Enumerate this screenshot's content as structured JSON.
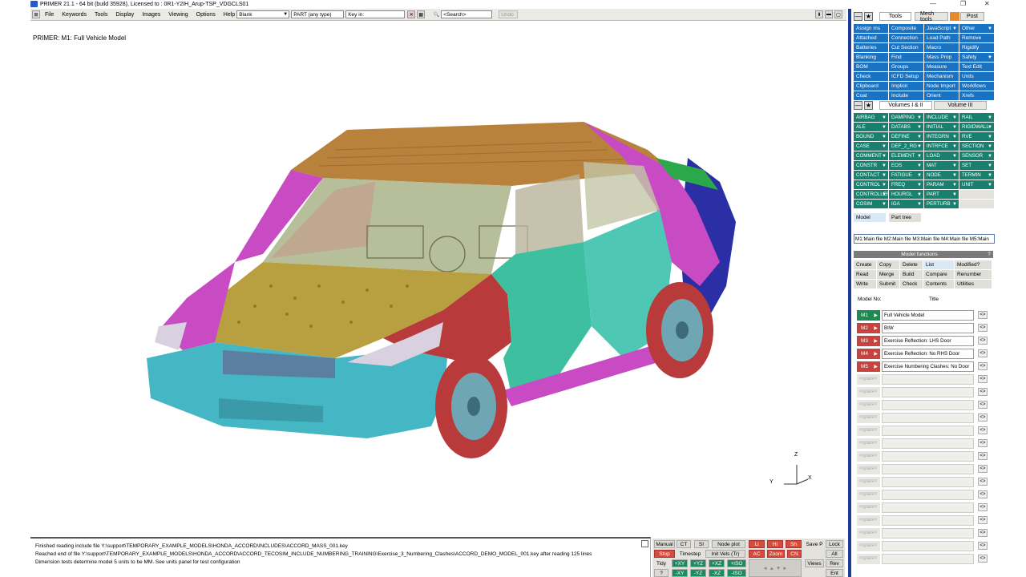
{
  "titlebar": {
    "title": "PRIMER 21.1 - 64 bit (build 35928), Licensed to : 0R1-Y2IH_Arup-TSP_VDGCLS01"
  },
  "menubar": {
    "items": [
      "File",
      "Keywords",
      "Tools",
      "Display",
      "Images",
      "Viewing",
      "Options",
      "Help"
    ],
    "blank_select": "Blank",
    "type_select": "PART  (any type)",
    "key_in_value": "Key in:",
    "search_value": "<Search>",
    "undo_label": "Undo"
  },
  "viewport": {
    "model_label": "PRIMER: M1: Full Vehicle Model",
    "triad": {
      "z": "Z",
      "y": "Y",
      "x": "X"
    }
  },
  "messages": [
    "Finished reading include file Y:\\support\\TEMPORARY_EXAMPLE_MODELS\\HONDA_ACCORD\\INCLUDES\\ACCORD_MASS_001.key",
    "Reached end of file Y:\\support\\TEMPORARY_EXAMPLE_MODELS\\HONDA_ACCORD\\ACCORD_TECOSIM_INCLUDE_NUMBERING_TRAINING\\Exercise_3_Numbering_Clashes\\ACCORD_DEMO_MODEL_001.key after reading 125 lines",
    "Dimension tests determine model 5 units to be MM. See units panel for test configuration"
  ],
  "bottom_controls": {
    "manual": "Manual",
    "ct": "CT",
    "si": "SI",
    "node_plot": "Node plot",
    "lock": "Lock",
    "stop": "Stop",
    "timestep": "Timestep",
    "init_vels": "Init Vels (Tr)",
    "ac": "AC",
    "zoom": "Zoom",
    "cn": "CN",
    "all": "All",
    "tidy": "Tidy",
    "pxy": "+XY",
    "pyz": "+YZ",
    "pxz": "+XZ",
    "piso": "+ISO",
    "views": "Views",
    "rev": "Rev",
    "q": "?",
    "mxy": "-XY",
    "myz": "-YZ",
    "mxz": "-XZ",
    "miso": "-ISO",
    "ent": "Ent",
    "save_p": "Save P",
    "li": "Li",
    "hi": "Hi",
    "sh": "Sh"
  },
  "tools_panel": {
    "tabs": [
      "Tools",
      "Mesh tools",
      "Post"
    ],
    "buttons": [
      "Assign ms",
      "Composite",
      "JavaScript",
      "Other",
      "Attached",
      "Connection",
      "Load Path",
      "Remove",
      "Batteries",
      "Cut Section",
      "Macro",
      "Rigidify",
      "Blanking",
      "Find",
      "Mass Prop",
      "Safety",
      "BOM",
      "Groups",
      "Measure",
      "Text Edit",
      "Check",
      "ICFD Setup",
      "Mechanism",
      "Units",
      "Clipboard",
      "Implicit",
      "Node Import",
      "Workflows",
      "Coat",
      "Include",
      "Orient",
      "Xrefs"
    ],
    "dropdown_buttons": [
      "JavaScript",
      "Other",
      "Safety"
    ]
  },
  "keywords_panel": {
    "tabs": [
      "Volumes I & II",
      "Volume III"
    ],
    "buttons": [
      "AIRBAG",
      "DAMPING",
      "INCLUDE",
      "RAIL",
      "ALE",
      "DATABS",
      "INITIAL",
      "RIGIDWALL",
      "BOUND",
      "DEFINE",
      "INTEGRN",
      "RVE",
      "CASE",
      "DEF_2_RG",
      "INTRFCE",
      "SECTION",
      "COMMENT",
      "ELEMENT",
      "LOAD",
      "SENSOR",
      "CONSTR",
      "EOS",
      "MAT",
      "SET",
      "CONTACT",
      "FATIGUE",
      "NODE",
      "TERMIN",
      "CONTROL",
      "FREQ",
      "PARAM",
      "UNIT",
      "CONTROLLER",
      "HOURGL",
      "PART",
      "",
      "COSIM",
      "IGA",
      "PERTURB",
      ""
    ],
    "model_tabs": [
      "Model",
      "Part tree"
    ],
    "model_list": "M1:Main file M2:Main file M3:Main file M4:Main file M5:Main"
  },
  "model_functions": {
    "header": "Model functions",
    "help": "?",
    "buttons": [
      "Create",
      "Copy",
      "Delete",
      "List",
      "Modified?",
      "Read",
      "Merge",
      "Build",
      "Compare",
      "Renumber",
      "Write",
      "Submit",
      "Check",
      "Contents",
      "Utilities"
    ],
    "col_model_no": "Model No:",
    "col_title": "Title",
    "models": [
      {
        "id": "M1",
        "title": "Full Vehicle Model",
        "color": "#1d8a52"
      },
      {
        "id": "M2",
        "title": "BIW",
        "color": "#c8423e"
      },
      {
        "id": "M3",
        "title": "Exercise Reflection: LHS Door",
        "color": "#c8423e"
      },
      {
        "id": "M4",
        "title": "Exercise Reflection: No RHS Door",
        "color": "#c8423e"
      },
      {
        "id": "M5",
        "title": "Exercise Numbering Clashes: No Door",
        "color": "#c8423e"
      }
    ],
    "spare_label": "<spare>",
    "arrow_label": "<>"
  }
}
